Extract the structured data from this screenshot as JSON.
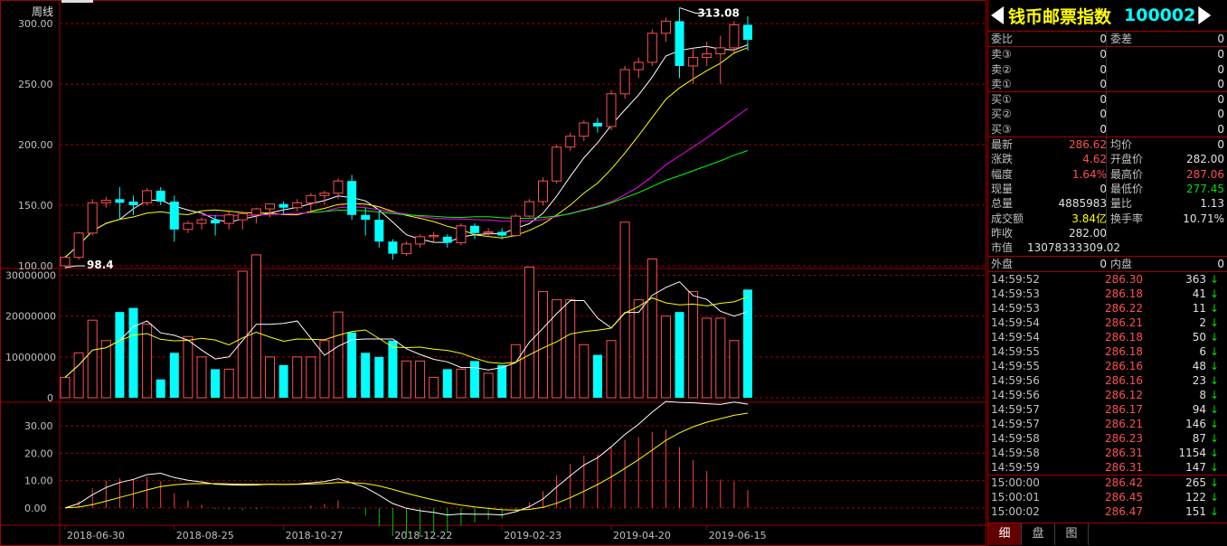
{
  "chart_data": {
    "type": "candlestick",
    "period_label": "周线",
    "dates_axis": [
      "2018-06-30",
      "2018-08-25",
      "2018-10-27",
      "2018-12-22",
      "2019-02-23",
      "2019-04-20",
      "2019-06-15"
    ],
    "price_axis": {
      "ticks": [
        "300.00",
        "250.00",
        "200.00",
        "150.00",
        "100.00"
      ],
      "ylim": [
        100,
        315
      ]
    },
    "volume_axis": {
      "ticks": [
        "30000000",
        "20000000",
        "10000000",
        "0"
      ],
      "ylim": [
        0,
        31000000
      ]
    },
    "indicator_axis": {
      "ticks": [
        "30.00",
        "20.00",
        "10.00",
        "0.00"
      ],
      "ylim": [
        -6,
        37
      ]
    },
    "high_label": "313.08",
    "low_label": "98.4",
    "candles": [
      {
        "o": 100,
        "h": 108,
        "l": 98.4,
        "c": 107,
        "v": 5000000
      },
      {
        "o": 107,
        "h": 128,
        "l": 105,
        "c": 127,
        "v": 11000000
      },
      {
        "o": 127,
        "h": 155,
        "l": 125,
        "c": 152,
        "v": 19000000
      },
      {
        "o": 152,
        "h": 157,
        "l": 148,
        "c": 154,
        "v": 14000000
      },
      {
        "o": 155,
        "h": 165,
        "l": 138,
        "c": 152,
        "v": 21000000
      },
      {
        "o": 153,
        "h": 158,
        "l": 142,
        "c": 150,
        "v": 22000000
      },
      {
        "o": 152,
        "h": 164,
        "l": 150,
        "c": 162,
        "v": 18000000
      },
      {
        "o": 162,
        "h": 165,
        "l": 150,
        "c": 153,
        "v": 4500000
      },
      {
        "o": 153,
        "h": 158,
        "l": 120,
        "c": 130,
        "v": 11000000
      },
      {
        "o": 130,
        "h": 137,
        "l": 127,
        "c": 135,
        "v": 15000000
      },
      {
        "o": 135,
        "h": 140,
        "l": 130,
        "c": 138,
        "v": 10000000
      },
      {
        "o": 138,
        "h": 142,
        "l": 125,
        "c": 135,
        "v": 7000000
      },
      {
        "o": 135,
        "h": 145,
        "l": 130,
        "c": 142,
        "v": 7000000
      },
      {
        "o": 138,
        "h": 145,
        "l": 130,
        "c": 143,
        "v": 31000000
      },
      {
        "o": 142,
        "h": 148,
        "l": 135,
        "c": 147,
        "v": 35000000
      },
      {
        "o": 147,
        "h": 151,
        "l": 140,
        "c": 151,
        "v": 10000000
      },
      {
        "o": 151,
        "h": 153,
        "l": 143,
        "c": 148,
        "v": 8000000
      },
      {
        "o": 148,
        "h": 155,
        "l": 145,
        "c": 152,
        "v": 10000000
      },
      {
        "o": 152,
        "h": 160,
        "l": 145,
        "c": 158,
        "v": 10000000
      },
      {
        "o": 158,
        "h": 162,
        "l": 150,
        "c": 160,
        "v": 14000000
      },
      {
        "o": 160,
        "h": 172,
        "l": 155,
        "c": 170,
        "v": 21000000
      },
      {
        "o": 170,
        "h": 175,
        "l": 138,
        "c": 142,
        "v": 16000000
      },
      {
        "o": 142,
        "h": 148,
        "l": 125,
        "c": 138,
        "v": 11000000
      },
      {
        "o": 138,
        "h": 145,
        "l": 115,
        "c": 120,
        "v": 10000000
      },
      {
        "o": 120,
        "h": 122,
        "l": 105,
        "c": 110,
        "v": 14000000
      },
      {
        "o": 110,
        "h": 120,
        "l": 108,
        "c": 118,
        "v": 9000000
      },
      {
        "o": 118,
        "h": 126,
        "l": 115,
        "c": 124,
        "v": 9000000
      },
      {
        "o": 124,
        "h": 128,
        "l": 120,
        "c": 125,
        "v": 5000000
      },
      {
        "o": 124,
        "h": 126,
        "l": 115,
        "c": 119,
        "v": 7000000
      },
      {
        "o": 119,
        "h": 135,
        "l": 117,
        "c": 133,
        "v": 7000000
      },
      {
        "o": 133,
        "h": 135,
        "l": 122,
        "c": 127,
        "v": 9000000
      },
      {
        "o": 127,
        "h": 131,
        "l": 124,
        "c": 128,
        "v": 6000000
      },
      {
        "o": 128,
        "h": 131,
        "l": 122,
        "c": 125,
        "v": 8000000
      },
      {
        "o": 125,
        "h": 143,
        "l": 124,
        "c": 141,
        "v": 13000000
      },
      {
        "o": 141,
        "h": 155,
        "l": 140,
        "c": 153,
        "v": 32000000
      },
      {
        "o": 153,
        "h": 173,
        "l": 150,
        "c": 170,
        "v": 26000000
      },
      {
        "o": 170,
        "h": 200,
        "l": 168,
        "c": 198,
        "v": 24000000
      },
      {
        "o": 198,
        "h": 210,
        "l": 195,
        "c": 207,
        "v": 24000000
      },
      {
        "o": 207,
        "h": 220,
        "l": 203,
        "c": 218,
        "v": 13000000
      },
      {
        "o": 218,
        "h": 222,
        "l": 210,
        "c": 215,
        "v": 10500000
      },
      {
        "o": 215,
        "h": 245,
        "l": 212,
        "c": 242,
        "v": 14000000
      },
      {
        "o": 242,
        "h": 265,
        "l": 238,
        "c": 262,
        "v": 43000000
      },
      {
        "o": 262,
        "h": 272,
        "l": 255,
        "c": 268,
        "v": 24000000
      },
      {
        "o": 268,
        "h": 295,
        "l": 265,
        "c": 292,
        "v": 34000000
      },
      {
        "o": 292,
        "h": 305,
        "l": 285,
        "c": 302,
        "v": 20000000
      },
      {
        "o": 302,
        "h": 313.08,
        "l": 255,
        "c": 265,
        "v": 21000000
      },
      {
        "o": 265,
        "h": 280,
        "l": 250,
        "c": 272,
        "v": 26000000
      },
      {
        "o": 272,
        "h": 285,
        "l": 265,
        "c": 275,
        "v": 19500000
      },
      {
        "o": 275,
        "h": 290,
        "l": 250,
        "c": 280,
        "v": 19500000
      },
      {
        "o": 280,
        "h": 302,
        "l": 276,
        "c": 299,
        "v": 14000000
      },
      {
        "o": 299,
        "h": 306,
        "l": 277.45,
        "c": 286.62,
        "v": 26500000
      }
    ],
    "indicator": {
      "dif_color": "#ffffff",
      "dea_color": "#ffff00",
      "bar_up_color": "#ff4040",
      "bar_down_color": "#00c000"
    },
    "colors": {
      "up": "#ff5050",
      "down": "#00ffff",
      "ma1": "#ffffff",
      "ma2": "#ffff00",
      "ma3": "#ff00ff",
      "ma4": "#00ff00",
      "grid": "#a00000"
    }
  },
  "panel": {
    "title_name": "钱币邮票指数",
    "title_code": "100002",
    "order_rows": [
      {
        "l1": "委比",
        "v1": "0",
        "l2": "委差",
        "v2": "0"
      }
    ],
    "sell_rows": [
      {
        "l": "卖③",
        "p": "0",
        "v": "0"
      },
      {
        "l": "卖②",
        "p": "0",
        "v": "0"
      },
      {
        "l": "卖①",
        "p": "0",
        "v": "0"
      }
    ],
    "buy_rows": [
      {
        "l": "买①",
        "p": "0",
        "v": "0"
      },
      {
        "l": "买②",
        "p": "0",
        "v": "0"
      },
      {
        "l": "买③",
        "p": "0",
        "v": "0"
      }
    ],
    "quote_rows": [
      {
        "l1": "最新",
        "v1": "286.62",
        "c1": "red",
        "l2": "均价",
        "v2": "0",
        "c2": "white"
      },
      {
        "l1": "涨跌",
        "v1": "4.62",
        "c1": "red",
        "l2": "开盘价",
        "v2": "282.00",
        "c2": "white"
      },
      {
        "l1": "幅度",
        "v1": "1.64%",
        "c1": "red",
        "l2": "最高价",
        "v2": "287.06",
        "c2": "red"
      },
      {
        "l1": "现量",
        "v1": "0",
        "c1": "white",
        "l2": "最低价",
        "v2": "277.45",
        "c2": "green"
      },
      {
        "l1": "总量",
        "v1": "4885983",
        "c1": "white",
        "l2": "量比",
        "v2": "1.13",
        "c2": "white"
      },
      {
        "l1": "成交额",
        "v1": "3.84亿",
        "c1": "yellow",
        "l2": "换手率",
        "v2": "10.71%",
        "c2": "white"
      },
      {
        "l1": "昨收",
        "v1": "282.00",
        "c1": "white",
        "l2": "",
        "v2": "",
        "c2": "white"
      },
      {
        "l1": "市值",
        "v1": "13078333309.02",
        "c1": "white",
        "l2": "",
        "v2": "",
        "c2": "white"
      }
    ],
    "outer_row": {
      "l1": "外盘",
      "v1": "0",
      "l2": "内盘",
      "v2": "0"
    },
    "ticks": [
      {
        "t": "14:59:52",
        "p": "286.30",
        "v": "363",
        "d": "↓"
      },
      {
        "t": "14:59:53",
        "p": "286.18",
        "v": "41",
        "d": "↓"
      },
      {
        "t": "14:59:53",
        "p": "286.22",
        "v": "11",
        "d": "↓"
      },
      {
        "t": "14:59:54",
        "p": "286.21",
        "v": "2",
        "d": "↓"
      },
      {
        "t": "14:59:54",
        "p": "286.18",
        "v": "50",
        "d": "↓"
      },
      {
        "t": "14:59:55",
        "p": "286.18",
        "v": "6",
        "d": "↓"
      },
      {
        "t": "14:59:55",
        "p": "286.16",
        "v": "48",
        "d": "↓"
      },
      {
        "t": "14:59:56",
        "p": "286.16",
        "v": "23",
        "d": "↓"
      },
      {
        "t": "14:59:56",
        "p": "286.12",
        "v": "8",
        "d": "↓"
      },
      {
        "t": "14:59:57",
        "p": "286.17",
        "v": "94",
        "d": "↓"
      },
      {
        "t": "14:59:57",
        "p": "286.21",
        "v": "146",
        "d": "↓"
      },
      {
        "t": "14:59:58",
        "p": "286.23",
        "v": "87",
        "d": "↓"
      },
      {
        "t": "14:59:58",
        "p": "286.31",
        "v": "1154",
        "d": "↓"
      },
      {
        "t": "14:59:59",
        "p": "286.31",
        "v": "147",
        "d": "↓"
      },
      {
        "t": "15:00:00",
        "p": "286.42",
        "v": "265",
        "d": "↓"
      },
      {
        "t": "15:00:01",
        "p": "286.45",
        "v": "122",
        "d": "↓"
      },
      {
        "t": "15:00:02",
        "p": "286.47",
        "v": "151",
        "d": "↓"
      }
    ],
    "tabs": [
      "细",
      "盘",
      "图"
    ]
  }
}
